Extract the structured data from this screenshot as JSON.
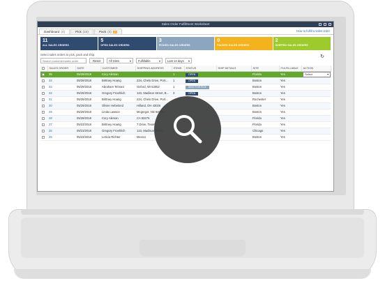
{
  "window": {
    "title": "Sales Order Fulfillment Worksheet"
  },
  "tabs": [
    {
      "label": "Dashboard",
      "count": "(4)",
      "badge": ""
    },
    {
      "label": "Pick",
      "count": "(16)",
      "badge": ""
    },
    {
      "label": "Pack",
      "count": "(0)",
      "badge": "(2)"
    }
  ],
  "help_link": "How to fulfill a sales order",
  "summary_tiles": [
    {
      "number": "11",
      "label": "ALL SALES ORDERS",
      "color": "#2f4c70"
    },
    {
      "number": "5",
      "label": "OPEN SALES ORDERS",
      "color": "#2f4c70"
    },
    {
      "number": "3",
      "label": "PICKED SALES ORDERS",
      "color": "#8da6c0"
    },
    {
      "number": "0",
      "label": "PACKED SALES ORDERS",
      "color": "#f4b21c"
    },
    {
      "number": "2",
      "label": "SHIPPED SALES ORDERS",
      "color": "#9dcb2b"
    }
  ],
  "instructions": "Select sales orders to pick, pack and ship.",
  "filters": {
    "search_placeholder": "Search customer/sales order",
    "reset_label": "Reset",
    "site_filter": "All Sites",
    "fulfill_filter": "Fulfillable",
    "date_filter": "Last 14 days"
  },
  "table": {
    "columns": [
      "SALES ORDER",
      "DATE",
      "CUSTOMER",
      "SHIPPING ADDRESS",
      "ITEMS",
      "STATUS",
      "SHIP DETAILS",
      "SITE",
      "FULFILLABLE",
      "ACTION"
    ],
    "rows": [
      {
        "so": "35",
        "date": "05/29/2018",
        "customer": "Cory Aikman",
        "address": "",
        "items": "1",
        "status": "OPEN",
        "ship": "",
        "site": "Florida",
        "fulfillable": "Yes",
        "action": "Select",
        "selected": true
      },
      {
        "so": "34",
        "date": "05/29/2018",
        "customer": "Brittney Hoang",
        "address": "234, Chelo Drive, Port...",
        "items": "1",
        "status": "OPEN",
        "ship": "",
        "site": "Boston",
        "fulfillable": "Yes",
        "action": "",
        "selected": false
      },
      {
        "so": "33",
        "date": "05/29/2018",
        "customer": "Abraham Tehrani",
        "address": "Oxford, WI 53052",
        "items": "1",
        "status": "SENT FOR PICK",
        "ship": "",
        "site": "Boston",
        "fulfillable": "Yes",
        "action": "",
        "selected": false
      },
      {
        "so": "32",
        "date": "05/29/2018",
        "customer": "Gregory Froehlich",
        "address": "123, Madison Street, B...",
        "items": "3",
        "status": "OPEN",
        "ship": "",
        "site": "Boston",
        "fulfillable": "Yes",
        "action": "",
        "selected": false
      },
      {
        "so": "31",
        "date": "05/29/2018",
        "customer": "Brittney Hoang",
        "address": "234, Chelo Drive, Port...",
        "items": "",
        "status": "",
        "ship": "",
        "site": "Rochester",
        "fulfillable": "Yes",
        "action": "",
        "selected": false
      },
      {
        "so": "30",
        "date": "05/29/2018",
        "customer": "Olivier Hebelond",
        "address": "Hilland, OH 43026",
        "items": "",
        "status": "",
        "ship": "",
        "site": "Boston",
        "fulfillable": "Yes",
        "action": "",
        "selected": false
      },
      {
        "so": "29",
        "date": "05/29/2018",
        "customer": "Linda Lawson",
        "address": "Mcgregor, ND 58755",
        "items": "",
        "status": "",
        "ship": "",
        "site": "Boston",
        "fulfillable": "Yes",
        "action": "",
        "selected": false
      },
      {
        "so": "28",
        "date": "05/29/2018",
        "customer": "Cory Aikman",
        "address": "CA 82275",
        "items": "",
        "status": "",
        "ship": "",
        "site": "Florida",
        "fulfillable": "Yes",
        "action": "",
        "selected": false
      },
      {
        "so": "27",
        "date": "05/23/2018",
        "customer": "Brittney Hoang",
        "address": "7 Drive, Texas",
        "items": "",
        "status": "",
        "ship": "",
        "site": "Florida",
        "fulfillable": "Yes",
        "action": "",
        "selected": false
      },
      {
        "so": "26",
        "date": "05/23/2018",
        "customer": "Gregory Froehlich",
        "address": "123, Madison Street",
        "items": "",
        "status": "",
        "ship": "",
        "site": "Chicago",
        "fulfillable": "Yes",
        "action": "",
        "selected": false
      },
      {
        "so": "25",
        "date": "05/23/2018",
        "customer": "Leticia Richter",
        "address": "Mexico",
        "items": "",
        "status": "",
        "ship": "",
        "site": "Boston",
        "fulfillable": "Yes",
        "action": "",
        "selected": false
      }
    ]
  },
  "icons": {
    "refresh": "refresh-icon",
    "overlay": "magnifier-icon"
  }
}
